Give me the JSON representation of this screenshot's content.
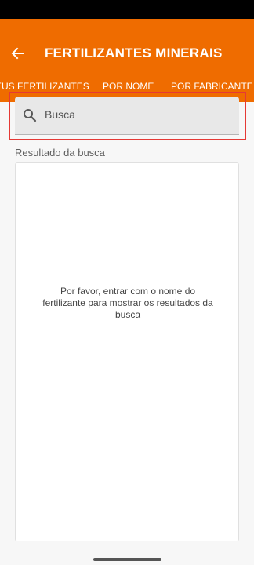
{
  "app_bar": {
    "title": "FERTILIZANTES MINERAIS",
    "back_icon": "arrow-left-icon",
    "color": "#ef6c00"
  },
  "tabs": [
    {
      "label": "MEUS FERTILIZANTES",
      "visible_label": "EUS FERTILIZANTES",
      "selected": false
    },
    {
      "label": "POR NOME",
      "selected": true
    },
    {
      "label": "POR FABRICANTE D",
      "selected": false
    }
  ],
  "search": {
    "placeholder": "Busca",
    "icon": "search-icon"
  },
  "results": {
    "label": "Resultado da busca",
    "empty_message": "Por favor, entrar com o nome do fertilizante para mostrar os resultados da busca"
  },
  "colors": {
    "accent": "#ef6c00",
    "highlight_border": "#e53935"
  }
}
